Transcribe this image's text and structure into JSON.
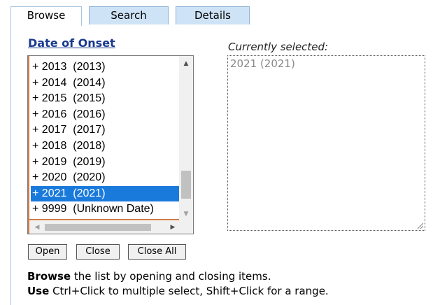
{
  "tabs": [
    {
      "label": "Browse",
      "active": true
    },
    {
      "label": "Search",
      "active": false
    },
    {
      "label": "Details",
      "active": false
    }
  ],
  "browse": {
    "heading": "Date of Onset",
    "items": [
      "+ 2013  (2013)",
      "+ 2014  (2014)",
      "+ 2015  (2015)",
      "+ 2016  (2016)",
      "+ 2017  (2017)",
      "+ 2018  (2018)",
      "+ 2019  (2019)",
      "+ 2020  (2020)",
      "+ 2021  (2021)",
      "+ 9999  (Unknown Date)"
    ],
    "selected_index": 8
  },
  "selected": {
    "label": "Currently selected:",
    "value": "2021 (2021)"
  },
  "buttons": {
    "open": "Open",
    "close": "Close",
    "close_all": "Close All"
  },
  "help": {
    "line1_bold": "Browse",
    "line1_rest": " the list by opening and closing items.",
    "line2_bold": "Use",
    "line2_rest": " Ctrl+Click to multiple select, Shift+Click for a range."
  },
  "colors": {
    "selection": "#1a7adb",
    "heading": "#1a3a8e",
    "tab_inactive": "#cfe3f7"
  }
}
